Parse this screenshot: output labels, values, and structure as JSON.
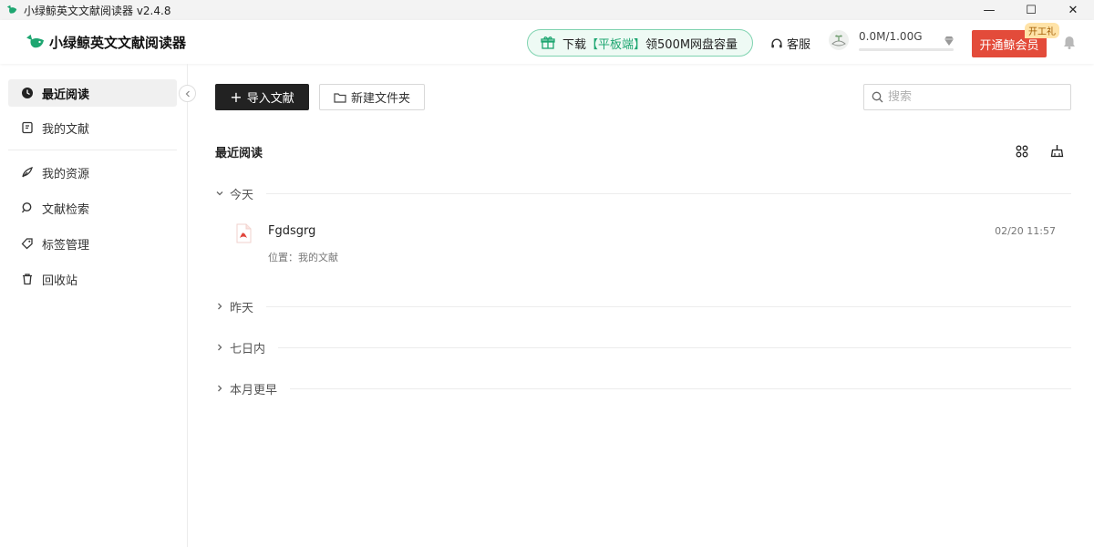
{
  "window": {
    "title": "小绿鲸英文文献阅读器 v2.4.8",
    "controls": [
      "—",
      "☐",
      "✕"
    ]
  },
  "header": {
    "brand": "小绿鲸英文文献阅读器",
    "promo": {
      "prefix": "下载",
      "highlight": "【平板端】",
      "suffix": "领500M网盘容量"
    },
    "service_label": "客服",
    "storage_text": "0.0M/1.00G",
    "storage_used_fraction": 0.0,
    "vip_button": "开通鲸会员",
    "vip_badge": "开工礼"
  },
  "sidebar": {
    "items": [
      {
        "label": "最近阅读",
        "icon": "clock-icon",
        "active": true
      },
      {
        "label": "我的文献",
        "icon": "document-icon",
        "active": false
      },
      {
        "label": "我的资源",
        "icon": "feather-icon",
        "active": false
      },
      {
        "label": "文献检索",
        "icon": "search-icon",
        "active": false
      },
      {
        "label": "标签管理",
        "icon": "tag-icon",
        "active": false
      },
      {
        "label": "回收站",
        "icon": "trash-icon",
        "active": false
      }
    ]
  },
  "main": {
    "import_button": "导入文献",
    "new_folder_button": "新建文件夹",
    "search_placeholder": "搜索",
    "section_title": "最近阅读",
    "groups": [
      {
        "label": "今天",
        "expanded": true
      },
      {
        "label": "昨天",
        "expanded": false
      },
      {
        "label": "七日内",
        "expanded": false
      },
      {
        "label": "本月更早",
        "expanded": false
      }
    ],
    "files": [
      {
        "name": "Fgdsgrg",
        "location": "位置：我的文献",
        "date": "02/20 11:57",
        "icon": "pdf-icon"
      }
    ]
  },
  "colors": {
    "brand_green": "#1ea671",
    "vip_red": "#e34b3a",
    "pdf_red": "#e0443a",
    "dark_button": "#222222"
  }
}
